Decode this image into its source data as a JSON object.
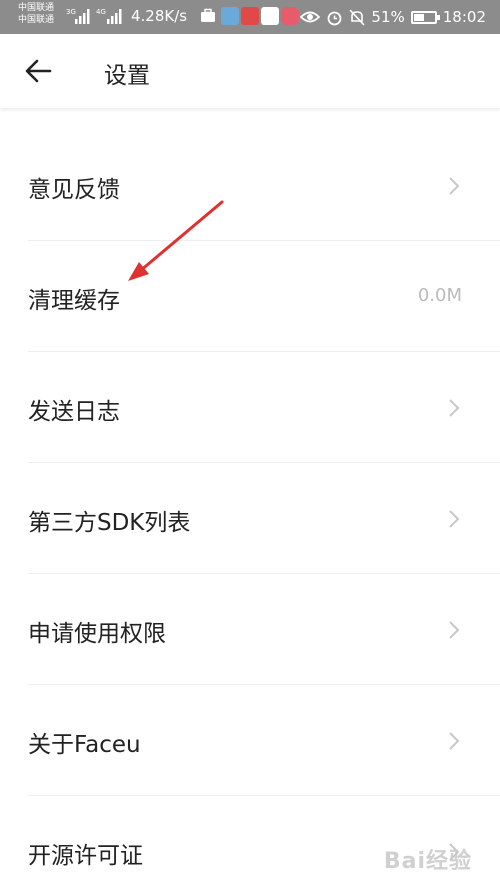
{
  "status_bar": {
    "carrier_1": "中国联通",
    "carrier_2": "中国联通",
    "net_1": "3G",
    "net_2": "4G",
    "speed": "4.28K/s",
    "battery": "51%",
    "battery_level": 0.51,
    "time": "18:02"
  },
  "header": {
    "title": "设置"
  },
  "items": [
    {
      "label": "意见反馈",
      "value": ""
    },
    {
      "label": "清理缓存",
      "value": "0.0M"
    },
    {
      "label": "发送日志",
      "value": ""
    },
    {
      "label": "第三方SDK列表",
      "value": ""
    },
    {
      "label": "申请使用权限",
      "value": ""
    },
    {
      "label": "关于Faceu",
      "value": ""
    },
    {
      "label": "开源许可证",
      "value": ""
    }
  ],
  "colors": {
    "status_bar": "#8c8c8c",
    "annotation_arrow": "#e03030",
    "divider": "#eeeeee"
  }
}
